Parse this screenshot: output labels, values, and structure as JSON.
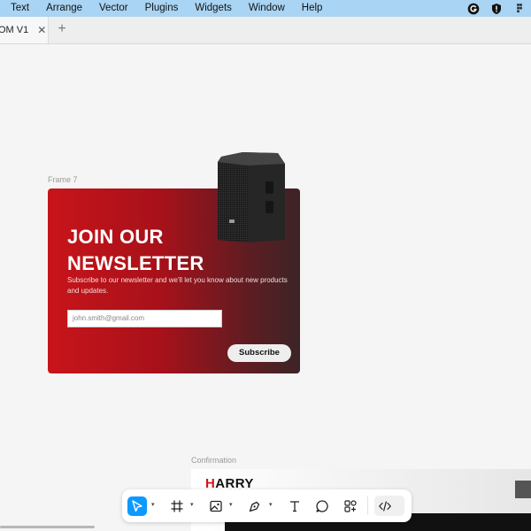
{
  "menubar": {
    "items": [
      "Text",
      "Arrange",
      "Vector",
      "Plugins",
      "Widgets",
      "Window",
      "Help"
    ],
    "status_icons": [
      "grammarly-icon",
      "shield-exclamation-icon",
      "figma-logo-icon"
    ]
  },
  "tabs": {
    "active": {
      "label": "OM V1",
      "close_glyph": "✕"
    },
    "new_tab_glyph": "+"
  },
  "canvas": {
    "frame7_label": "Frame 7",
    "confirmation_label": "Confirmation"
  },
  "newsletter": {
    "title_line1": "JOIN OUR",
    "title_line2": "NEWSLETTER",
    "subtitle": "Subscribe to our newsletter and we'll let you know about new products and updates.",
    "email_placeholder": "john.smith@gmail.com",
    "subscribe_label": "Subscribe"
  },
  "confirmation": {
    "brand_first": "H",
    "brand_rest": "ARRY"
  },
  "toolbar": {
    "tools": [
      "move-tool",
      "frame-tool",
      "image-tool",
      "pen-tool",
      "text-tool",
      "comment-tool",
      "components-tool",
      "dev-mode-toggle"
    ]
  },
  "colors": {
    "accent": "#0d99ff",
    "card_red": "#c8141a",
    "menubar": "#a9d4f3"
  }
}
